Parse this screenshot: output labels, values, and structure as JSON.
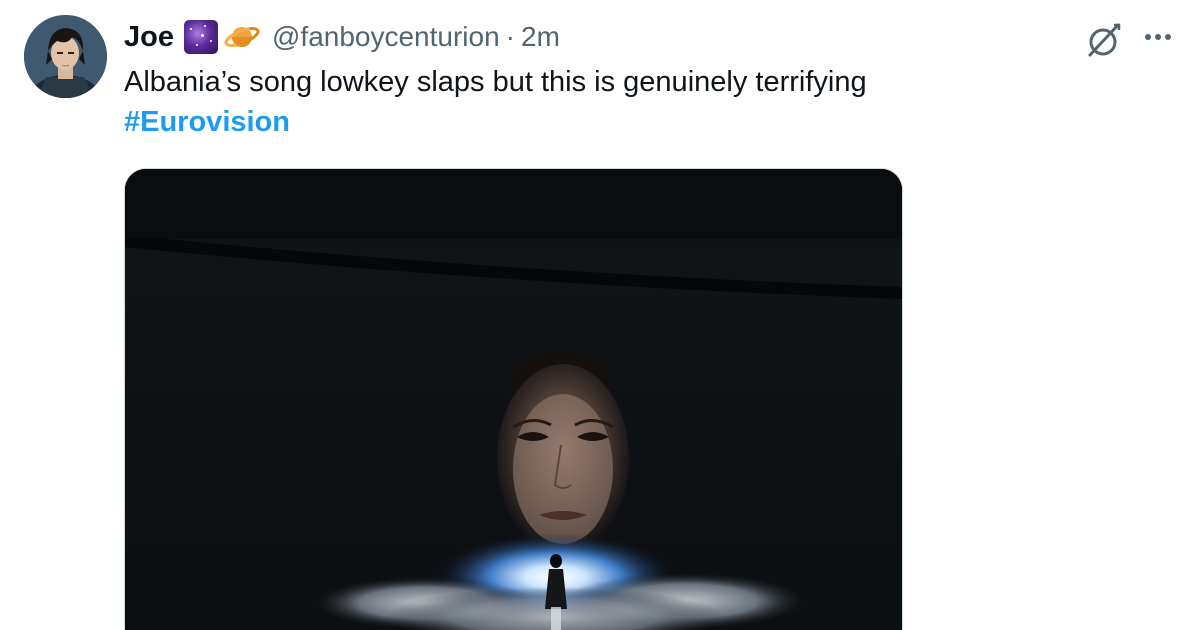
{
  "tweet": {
    "author": {
      "display_name": "Joe",
      "emoji": [
        "milky-way-emoji",
        "ringed-planet-emoji"
      ],
      "handle": "@fanboycenturion",
      "separator": "·",
      "time_ago": "2m"
    },
    "text": "Albania’s song lowkey slaps but this is genuinely terrifying",
    "hashtag": "#Eurovision",
    "media": {
      "description_icon": "photo",
      "kind": "image"
    },
    "actions": {
      "grok_icon": "grok-icon",
      "more_icon": "more-options-icon"
    },
    "colors": {
      "link": "#1d9bf0",
      "secondary_text": "#536471",
      "primary_text": "#0f1419"
    }
  }
}
